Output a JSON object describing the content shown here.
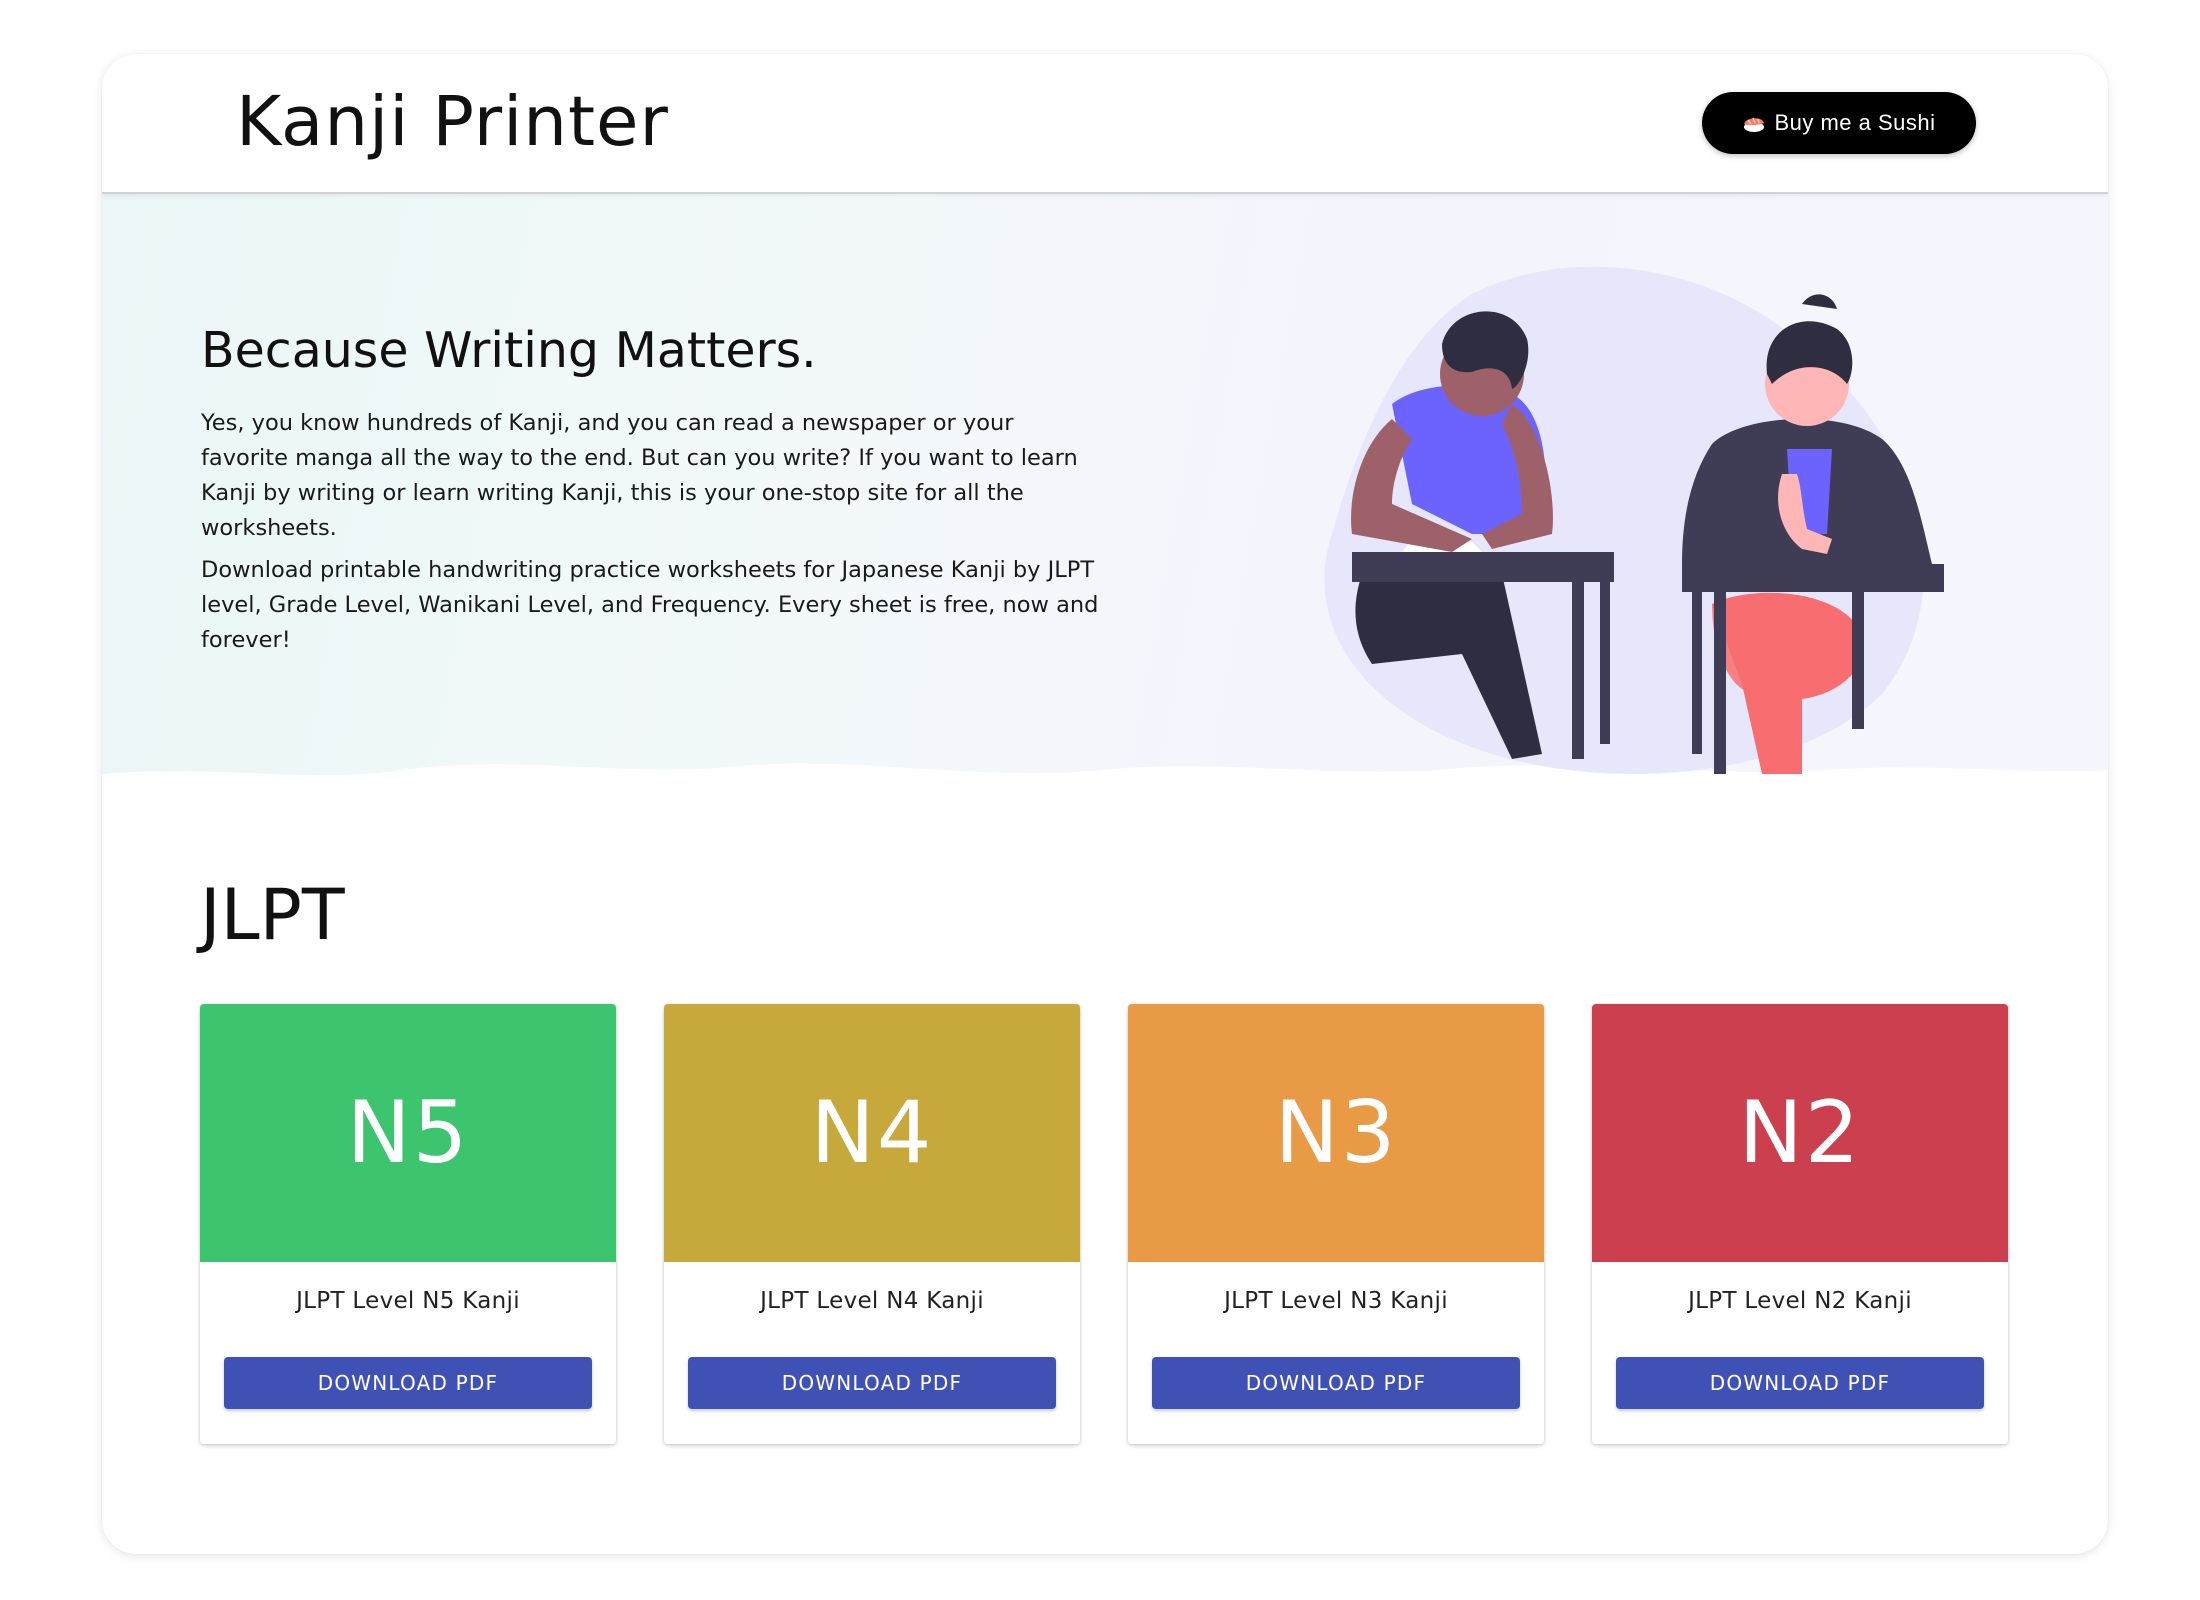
{
  "header": {
    "title": "Kanji Printer",
    "sushi_button": "Buy me a Sushi",
    "sushi_icon": "sushi-icon"
  },
  "hero": {
    "title": "Because Writing Matters.",
    "paragraphs": [
      "Yes, you know hundreds of Kanji, and you can read a newspaper or your favorite manga all the way to the end. But can you write? If you want to learn Kanji by writing or learn writing Kanji, this is your one-stop site for all the worksheets.",
      "Download printable handwriting practice worksheets for Japanese Kanji by JLPT level, Grade Level, Wanikani Level, and Frequency. Every sheet is free, now and forever!"
    ],
    "illustration": "students-writing-illustration"
  },
  "section": {
    "title": "JLPT"
  },
  "cards": [
    {
      "level": "N5",
      "label": "JLPT Level N5 Kanji",
      "button": "DOWNLOAD PDF",
      "color": "#3cc46f"
    },
    {
      "level": "N4",
      "label": "JLPT Level N4 Kanji",
      "button": "DOWNLOAD PDF",
      "color": "#c7a83a"
    },
    {
      "level": "N3",
      "label": "JLPT Level N3 Kanji",
      "button": "DOWNLOAD PDF",
      "color": "#e89a44"
    },
    {
      "level": "N2",
      "label": "JLPT Level N2 Kanji",
      "button": "DOWNLOAD PDF",
      "color": "#cc3f4f"
    }
  ],
  "colors": {
    "accent": "#3f51b5",
    "header_button_bg": "#000000"
  }
}
